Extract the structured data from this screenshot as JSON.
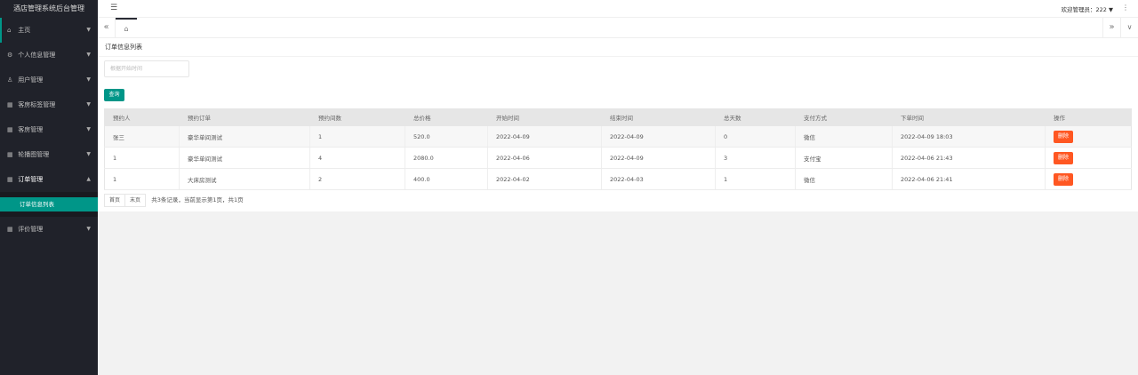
{
  "app": {
    "title": "酒店管理系统后台管理"
  },
  "header": {
    "user_label": "欢迎管理员：222",
    "user_caret": "▼",
    "more_glyph": "⋮",
    "menu_glyph": "☰"
  },
  "tabs": {
    "left_glyph": "«",
    "home_glyph": "⌂",
    "right_glyph": "»",
    "down_glyph": "∨"
  },
  "sidebar": {
    "items": [
      {
        "label": "主页",
        "icon": "⌂",
        "arrow": "▼"
      },
      {
        "label": "个人信息管理",
        "icon": "⚙",
        "arrow": "▼"
      },
      {
        "label": "用户管理",
        "icon": "♙",
        "arrow": "▼"
      },
      {
        "label": "客房标签管理",
        "icon": "▦",
        "arrow": "▼"
      },
      {
        "label": "客房管理",
        "icon": "▦",
        "arrow": "▼"
      },
      {
        "label": "轮播图管理",
        "icon": "▦",
        "arrow": "▼"
      },
      {
        "label": "订单管理",
        "icon": "▦",
        "arrow": "▲"
      },
      {
        "label": "评价管理",
        "icon": "▦",
        "arrow": "▼"
      }
    ],
    "sub_item": "订单信息列表"
  },
  "main": {
    "card_title": "订单信息列表",
    "search_placeholder": "根据开始时间",
    "query_label": "查询",
    "columns": [
      "预约人",
      "预约订单",
      "预约间数",
      "总价格",
      "开始时间",
      "结束时间",
      "总天数",
      "支付方式",
      "下单时间",
      "操作"
    ],
    "rows": [
      [
        "张三",
        "豪华单间测试",
        "1",
        "520.0",
        "2022-04-09",
        "2022-04-09",
        "0",
        "微信",
        "2022-04-09 18:03",
        "删除"
      ],
      [
        "1",
        "豪华单间测试",
        "4",
        "2080.0",
        "2022-04-06",
        "2022-04-09",
        "3",
        "支付宝",
        "2022-04-06 21:43",
        "删除"
      ],
      [
        "1",
        "大床房测试",
        "2",
        "400.0",
        "2022-04-02",
        "2022-04-03",
        "1",
        "微信",
        "2022-04-06 21:41",
        "删除"
      ]
    ],
    "pager": {
      "first": "首页",
      "last": "末页",
      "info": "共3条记录，当前显示第1页，共1页"
    }
  },
  "colors": {
    "accent": "#009688",
    "danger": "#ff5722",
    "sidebar": "#20222a"
  }
}
